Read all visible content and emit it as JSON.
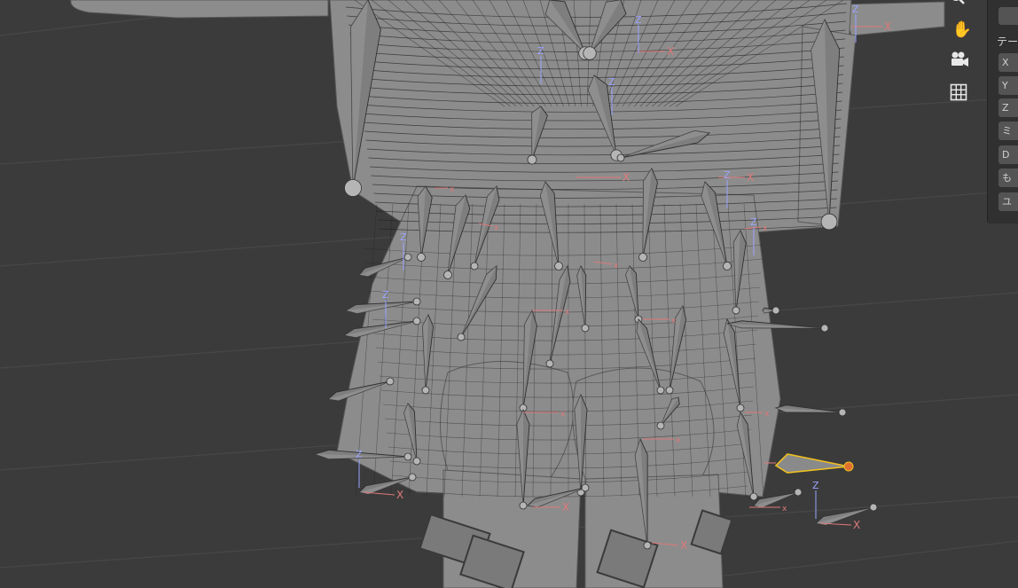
{
  "viewport": {
    "background": "#3b3b3b",
    "grid_color": "#474747",
    "mesh_color": "#8c8c8c",
    "wire_color": "#222222",
    "bone_color": "#7e7e7e",
    "bone_selected_outline": "#f0c020",
    "bone_selected_tip": "#e07030",
    "axis_x_color": "#e07878",
    "axis_z_color": "#9aa4ff",
    "axis_x_label": "X",
    "axis_small_x_label": "x",
    "axis_z_label": "Z"
  },
  "navigation_gizmo": {
    "zoom": {
      "icon": "zoom-magnifier-icon"
    },
    "pan": {
      "icon": "hand-pan-icon",
      "glyph": "✋"
    },
    "camera": {
      "icon": "camera-icon"
    },
    "ortho": {
      "icon": "grid-ortho-icon"
    }
  },
  "sidebar": {
    "tab_label": "テー",
    "fields": [
      "X",
      "Y",
      "Z",
      "ミ",
      "D",
      "も",
      "ユ"
    ]
  }
}
